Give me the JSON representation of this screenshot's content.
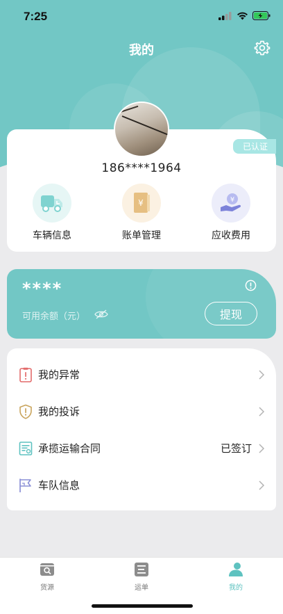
{
  "status_bar": {
    "time": "7:25"
  },
  "header": {
    "title": "我的"
  },
  "profile": {
    "verified_badge": "已认证",
    "phone": "186****1964",
    "quick_actions": [
      {
        "label": "车辆信息",
        "icon": "truck-icon"
      },
      {
        "label": "账单管理",
        "icon": "bill-book-icon"
      },
      {
        "label": "应收费用",
        "icon": "hand-money-icon"
      }
    ]
  },
  "wallet": {
    "amount_masked": "****",
    "balance_label": "可用余额（元）",
    "withdraw_label": "提现"
  },
  "menu": {
    "items": [
      {
        "label": "我的异常",
        "value": "",
        "icon": "exception-clipboard-icon"
      },
      {
        "label": "我的投诉",
        "value": "",
        "icon": "shield-warning-icon"
      },
      {
        "label": "承揽运输合同",
        "value": "已签订",
        "icon": "contract-icon"
      },
      {
        "label": "车队信息",
        "value": "",
        "icon": "flag-icon"
      }
    ]
  },
  "tabbar": {
    "tabs": [
      {
        "label": "货源",
        "icon": "cargo-search-icon",
        "active": false
      },
      {
        "label": "运单",
        "icon": "waybill-icon",
        "active": false
      },
      {
        "label": "我的",
        "icon": "profile-icon",
        "active": true
      }
    ]
  },
  "colors": {
    "accent": "#72c7c5",
    "background": "#ebebed",
    "active_tab": "#5ec2c0"
  }
}
